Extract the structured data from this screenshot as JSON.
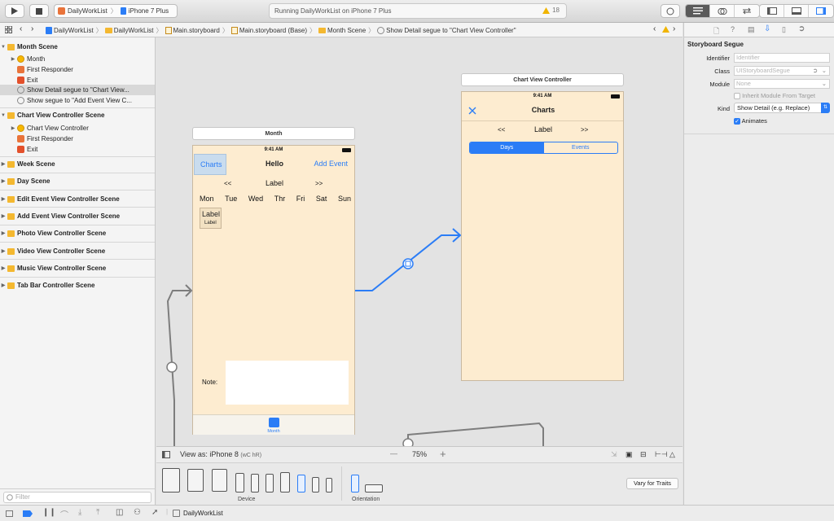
{
  "toolbar": {
    "scheme_target": "DailyWorkList",
    "scheme_device": "iPhone 7 Plus",
    "activity_text": "Running DailyWorkList on iPhone 7 Plus",
    "warning_count": "18"
  },
  "jumpbar": {
    "items": [
      "DailyWorkList",
      "DailyWorkList",
      "Main.storyboard",
      "Main.storyboard (Base)",
      "Month Scene",
      "Show Detail segue to \"Chart View Controller\""
    ]
  },
  "navigator": {
    "rows": [
      {
        "label": "Month Scene"
      },
      {
        "label": "Month"
      },
      {
        "label": "First Responder"
      },
      {
        "label": "Exit"
      },
      {
        "label": "Show Detail segue to \"Chart View..."
      },
      {
        "label": "Show segue to \"Add Event View C..."
      },
      {
        "label": "Chart View Controller Scene"
      },
      {
        "label": "Chart View Controller"
      },
      {
        "label": "First Responder"
      },
      {
        "label": "Exit"
      },
      {
        "label": "Week Scene"
      },
      {
        "label": "Day Scene"
      },
      {
        "label": "Edit Event View Controller Scene"
      },
      {
        "label": "Add Event View Controller Scene"
      },
      {
        "label": "Photo View Controller Scene"
      },
      {
        "label": "Video View Controller Scene"
      },
      {
        "label": "Music View Controller Scene"
      },
      {
        "label": "Tab Bar Controller Scene"
      }
    ],
    "filter_placeholder": "Filter"
  },
  "month_scene": {
    "title": "Month",
    "time": "9:41 AM",
    "nav_left": "Charts",
    "nav_title": "Hello",
    "nav_right": "Add Event",
    "prev": "<<",
    "label": "Label",
    "next": ">>",
    "weekdays": [
      "Mon",
      "Tue",
      "Wed",
      "Thr",
      "Fri",
      "Sat",
      "Sun"
    ],
    "cell_label": "Label",
    "cell_sublabel": "Label",
    "note_label": "Note:",
    "tab_label": "Month"
  },
  "chart_scene": {
    "title": "Chart View Controller",
    "time": "9:41 AM",
    "nav_title": "Charts",
    "prev": "<<",
    "label": "Label",
    "next": ">>",
    "segments": [
      "Days",
      "Events"
    ]
  },
  "canvas_bar": {
    "view_as_prefix": "View as: ",
    "view_as_device": "iPhone 8",
    "size_class": "(wC hR)",
    "zoom": "75%",
    "zoom_out": "—",
    "zoom_in": "+"
  },
  "tray": {
    "device_label": "Device",
    "orientation_label": "Orientation",
    "vary_button": "Vary for Traits"
  },
  "debug": {
    "target": "DailyWorkList"
  },
  "inspector": {
    "section_title": "Storyboard Segue",
    "identifier_label": "Identifier",
    "identifier_placeholder": "Identifier",
    "class_label": "Class",
    "class_placeholder": "UIStoryboardSegue",
    "module_label": "Module",
    "module_placeholder": "None",
    "inherit_label": "Inherit Module From Target",
    "kind_label": "Kind",
    "kind_value": "Show Detail (e.g. Replace)",
    "animates_label": "Animates"
  },
  "colors": {
    "accent": "#2b7df6",
    "scene_bg": "#fdecd0",
    "segue_line": "#2b7df6"
  }
}
